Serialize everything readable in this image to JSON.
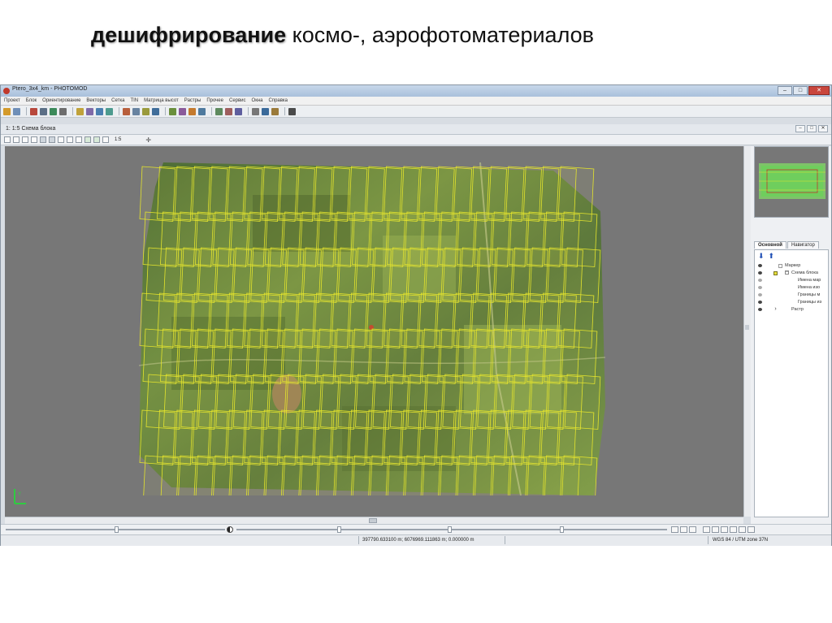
{
  "slide": {
    "title_bold": "дешифрирование",
    "title_rest": " космо-, аэрофотоматериалов"
  },
  "window": {
    "title": "Ptero_3x4_km - PHOTOMOD",
    "min_label": "–",
    "max_label": "□",
    "close_label": "✕"
  },
  "menu": {
    "items": [
      "Проект",
      "Блок",
      "Ориентирование",
      "Векторы",
      "Сетка",
      "TIN",
      "Матрица высот",
      "Растры",
      "Прочее",
      "Сервис",
      "Окна",
      "Справка"
    ]
  },
  "document": {
    "title": "1: 1:5 Схема блока",
    "scale_label": "1:5"
  },
  "status": {
    "coords": "397790.633100 m; 6076969.111863 m; 0.000000 m",
    "crs": "WGS 84 / UTM zone 37N"
  },
  "right_panel": {
    "tabs": [
      "Основной",
      "Навигатор"
    ],
    "layers": [
      {
        "label": "Маркер",
        "indent": 0
      },
      {
        "label": "Схема блока",
        "indent": 0
      },
      {
        "label": "Имена мар",
        "indent": 1
      },
      {
        "label": "Имена изо",
        "indent": 1
      },
      {
        "label": "Границы м",
        "indent": 1
      },
      {
        "label": "Границы из",
        "indent": 1
      },
      {
        "label": "Растр",
        "indent": 0
      }
    ]
  },
  "colors": {
    "canvas_bg": "#777777",
    "footprint_outline": "#e4e42c",
    "terrain_forest": "#4f6a3a",
    "terrain_field": "#7d9a4a",
    "selection_blue": "#1f4fb5"
  },
  "icons": [
    "app-icon",
    "arrow-down-icon",
    "arrow-up-icon",
    "eye-icon",
    "axis-icon"
  ]
}
